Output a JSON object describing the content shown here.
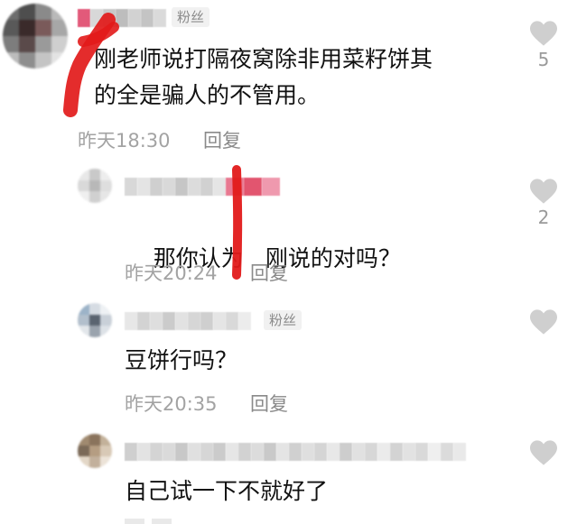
{
  "comments": [
    {
      "badge": "粉丝",
      "text_line1": "刚老师说打隔夜窝除非用菜籽饼其",
      "text_line2": "的全是骗人的不管用。",
      "time": "昨天18:30",
      "reply_label": "回复",
      "likes": "5"
    },
    {
      "text": "那你认为",
      "text_tail": "刚说的对吗？",
      "time": "昨天20:24",
      "reply_label": "回复",
      "likes": "2"
    },
    {
      "badge": "粉丝",
      "text": "豆饼行吗？",
      "time": "昨天20:35",
      "reply_label": "回复",
      "likes": ""
    },
    {
      "text": "自己试一下不就好了",
      "likes": ""
    }
  ],
  "colors": {
    "like_icon": "#cfcfcf",
    "marker_red": "#e21a1a",
    "meta_text": "#a3a3a3"
  },
  "icons": {
    "like": "heart-icon"
  }
}
